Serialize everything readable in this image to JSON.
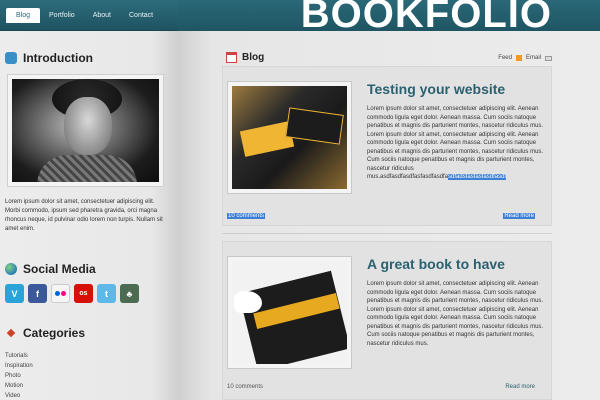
{
  "nav": {
    "items": [
      "Blog",
      "Portfolio",
      "About",
      "Contact"
    ],
    "active": "Blog"
  },
  "logo": "BOOKFOLIO",
  "sidebar": {
    "intro_title": "Introduction",
    "intro_text": "Lorem ipsum dolor sit amet, consectetuer adipiscing elit. Morbi commodo, ipsum sed pharetra gravida, orci magna rhoncus neque, id pulvinar odio lorem non turpis. Nullam sit amet enim.",
    "social_title": "Social Media",
    "social_icons": [
      "vimeo-icon",
      "facebook-icon",
      "flickr-icon",
      "lastfm-icon",
      "twitter-icon",
      "deviantart-icon"
    ],
    "categories_title": "Categories",
    "categories": [
      "Tutorials",
      "Inspiration",
      "Photo",
      "Motion",
      "Video"
    ]
  },
  "blog": {
    "title": "Blog",
    "feed_label": "Feed",
    "email_label": "Email",
    "posts": [
      {
        "title": "Testing your website",
        "body": "Lorem ipsum dolor sit amet, consectetuer adipiscing elit. Aenean commodo ligula eget dolor. Aenean massa. Cum sociis natoque penatibus et magnis dis parturient montes, nascetur ridiculus mus. Lorem ipsum dolor sit amet, consectetuer adipiscing elit. Aenean commodo ligula eget dolor. Aenean massa. Cum sociis natoque penatibus et magnis dis parturient montes, nascetur ridiculus mus. Cum sociis natoque penatibus et magnis dis parturient montes, nascetur ridiculus mus.asdfasdfasdfasfasdfasdfa",
        "body_selected": "sdfadsfasfasfasdfasdf",
        "comments": "10 comments",
        "read_more": "Read more"
      },
      {
        "title": "A great book to have",
        "body": "Lorem ipsum dolor sit amet, consectetuer adipiscing elit. Aenean commodo ligula eget dolor. Aenean massa. Cum sociis natoque penatibus et magnis dis parturient montes, nascetur ridiculus mus. Lorem ipsum dolor sit amet, consectetuer adipiscing elit. Aenean commodo ligula eget dolor. Aenean massa. Cum sociis natoque penatibus et magnis dis parturient montes, nascetur ridiculus mus. Cum sociis natoque penatibus et magnis dis parturient montes, nascetur ridiculus mus.",
        "comments": "10 comments",
        "read_more": "Read more"
      }
    ]
  }
}
